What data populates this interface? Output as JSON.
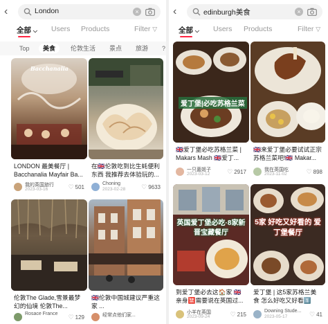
{
  "left": {
    "search_query": "London",
    "tabs": [
      "全部",
      "Users",
      "Products"
    ],
    "filter_label": "Filter",
    "chips": [
      "Top",
      "美食",
      "伦敦生活",
      "景点",
      "旅游",
      "?"
    ],
    "selected_chip": "美食",
    "cards": [
      {
        "title": "LONDON 最美餐厅 | Bacchanalia Mayfair Ba...",
        "author": "我的英国旅行",
        "date": "2023-03-16",
        "likes": "501",
        "image_caption": "Bacchanalia"
      },
      {
        "title": "在🇬🇧伦敦吃到比生蚝便利东西 我推荐去体验玩的...",
        "author": "Choning",
        "date": "2023-02-28",
        "likes": "9633",
        "image_caption": ""
      },
      {
        "title": "伦敦The Glade,雪景最梦幻的仙境 伦敦The...",
        "author": "Rosace France",
        "date": "",
        "likes": "129",
        "image_caption": ""
      },
      {
        "title": "🇬🇧伦敦中国城建议严重这家 ...",
        "author": "经常点他们家...",
        "date": "",
        "likes": "",
        "image_caption": ""
      }
    ]
  },
  "right": {
    "search_query": "edinburgh美食",
    "tabs": [
      "全部",
      "Users",
      "Products"
    ],
    "filter_label": "Filter",
    "cards": [
      {
        "title": "🇬🇧爱丁堡必吃苏格兰菜 | Makars Mash 🇬🇧爱丁...",
        "author": "一只菌姬子",
        "date": "2023-03-12",
        "likes": "2917",
        "overlay": "爱丁堡|必吃苏格兰菜"
      },
      {
        "title": "🇬🇧来爱丁堡必要试试正宗苏格兰菜吧!🇬🇧 Makar...",
        "author": "我在英国吃",
        "date": "2023-11-02",
        "likes": "898",
        "overlay": ""
      },
      {
        "title": "到爱丁堡必去这🏠家 🇬🇧亲身🈲需要说在英国过...",
        "author": "小羊在英国",
        "date": "2023-09-24",
        "likes": "215",
        "overlay": "英国爱丁堡必吃·8家新晋宝藏餐厅"
      },
      {
        "title": "爱丁堡 | 这5家苏格兰美食 怎么好吃又好看1️⃣ Th...",
        "author": "Downing Stude...",
        "date": "2023-05-17",
        "likes": "41",
        "overlay": "5家 好吃又好看的 爱丁堡餐厅"
      }
    ]
  },
  "colors": {
    "accent": "#ff2442",
    "muted": "#999999"
  }
}
